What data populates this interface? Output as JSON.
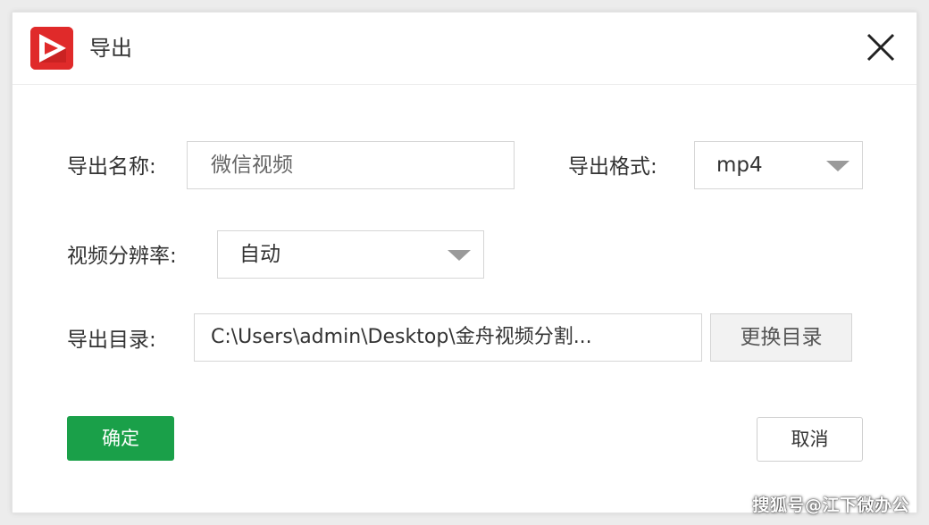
{
  "dialog": {
    "title": "导出",
    "app_icon": "app-logo-icon",
    "close_icon": "close-icon"
  },
  "form": {
    "name_label": "导出名称:",
    "name_value": "微信视频",
    "format_label": "导出格式:",
    "format_value": "mp4",
    "resolution_label": "视频分辨率:",
    "resolution_value": "自动",
    "dir_label": "导出目录:",
    "dir_value": "C:\\Users\\admin\\Desktop\\金舟视频分割...",
    "change_dir_label": "更换目录"
  },
  "actions": {
    "confirm_label": "确定",
    "cancel_label": "取消"
  },
  "watermark": "搜狐号@江下微办公",
  "colors": {
    "primary": "#1aa049",
    "brand_red": "#e02a2a"
  }
}
